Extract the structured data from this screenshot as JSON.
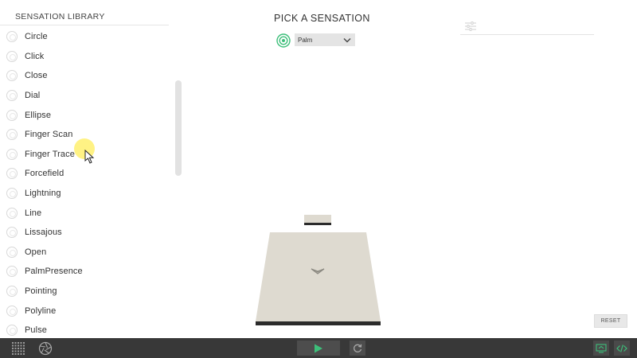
{
  "sidebar": {
    "title": "SENSATION LIBRARY",
    "items": [
      {
        "label": "Circle"
      },
      {
        "label": "Click"
      },
      {
        "label": "Close"
      },
      {
        "label": "Dial"
      },
      {
        "label": "Ellipse"
      },
      {
        "label": "Finger Scan"
      },
      {
        "label": "Finger Trace"
      },
      {
        "label": "Forcefield"
      },
      {
        "label": "Lightning"
      },
      {
        "label": "Line"
      },
      {
        "label": "Lissajous"
      },
      {
        "label": "Open"
      },
      {
        "label": "PalmPresence"
      },
      {
        "label": "Pointing"
      },
      {
        "label": "Polyline"
      },
      {
        "label": "Pulse"
      }
    ]
  },
  "header": {
    "title": "PICK A SENSATION",
    "hand_position": "Palm"
  },
  "controls": {
    "reset_label": "RESET"
  },
  "icons": {
    "target": "target-icon",
    "dropdown": "chevron-down-icon",
    "settings": "sliders-icon",
    "grid": "grid-icon",
    "aperture": "aperture-icon",
    "play": "play-icon",
    "replay": "replay-icon",
    "stream": "stream-icon",
    "code": "code-icon"
  },
  "colors": {
    "accent_green": "#3dbf7a",
    "bottom_bar": "#383838",
    "device_surface": "#dedad0",
    "device_edge": "#2b2b2b"
  }
}
